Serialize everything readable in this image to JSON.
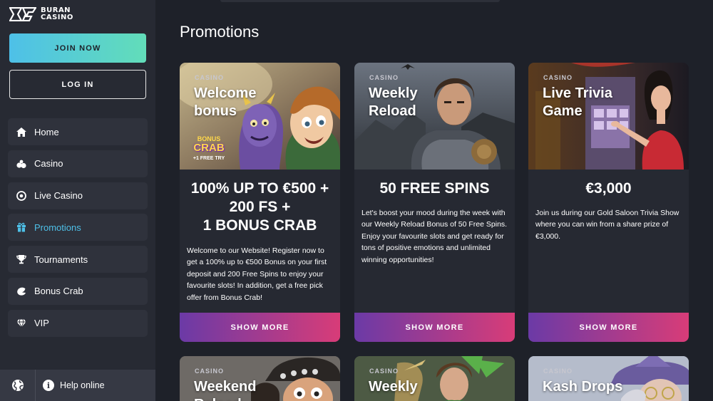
{
  "brand": {
    "line1": "BURAN",
    "line2": "CASINO"
  },
  "sidebar": {
    "join_label": "JOIN NOW",
    "login_label": "LOG IN",
    "items": [
      {
        "label": "Home",
        "icon": "home-icon"
      },
      {
        "label": "Casino",
        "icon": "casino-icon"
      },
      {
        "label": "Live Casino",
        "icon": "live-casino-icon"
      },
      {
        "label": "Promotions",
        "icon": "gift-icon",
        "active": true
      },
      {
        "label": "Tournaments",
        "icon": "trophy-icon"
      },
      {
        "label": "Bonus Crab",
        "icon": "crab-icon"
      },
      {
        "label": "VIP",
        "icon": "diamond-icon"
      }
    ],
    "help_label": "Help online"
  },
  "main": {
    "title": "Promotions",
    "cards": [
      {
        "category": "CASINO",
        "title": "Welcome bonus",
        "offer_lines": [
          "100% UP TO €500 +",
          "200 FS +",
          "1 BONUS CRAB"
        ],
        "description": "Welcome to our Website! Register now to get a 100% up to €500 Bonus on your first deposit and 200 Free Spins to enjoy your favourite slots! In addition, get a free pick offer from Bonus Crab!",
        "button": "SHOW MORE",
        "badge_top": "BONUS",
        "badge_main": "CRAB",
        "badge_sub": "+1 FREE TRY"
      },
      {
        "category": "CASINO",
        "title": "Weekly Reload",
        "offer_lines": [
          "50 FREE SPINS"
        ],
        "description": "Let's boost your mood during the week with our Weekly Reload Bonus of 50 Free Spins. Enjoy your favourite slots and get ready for tons of positive emotions and unlimited winning opportunities!",
        "button": "SHOW MORE"
      },
      {
        "category": "CASINO",
        "title": "Live Trivia Game",
        "offer_lines": [
          "€3,000"
        ],
        "description": "Join us during our Gold Saloon Trivia Show where you can win from a share prize of €3,000.",
        "button": "SHOW MORE"
      },
      {
        "category": "CASINO",
        "title": "Weekend Reload"
      },
      {
        "category": "CASINO",
        "title": "Weekly"
      },
      {
        "category": "CASINO",
        "title": "Kash Drops"
      }
    ]
  },
  "colors": {
    "accent_cyan": "#4ec0e8",
    "accent_green": "#62ddb9",
    "gradient_purple": "#6b3aa6",
    "gradient_pink": "#d83c78",
    "background": "#1e2129"
  }
}
